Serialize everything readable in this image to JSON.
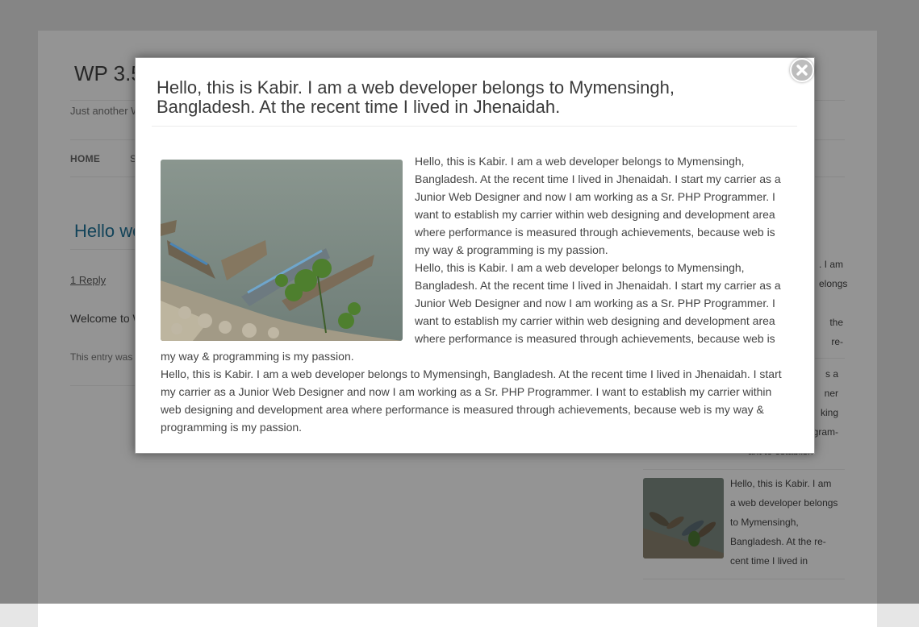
{
  "site": {
    "title": "WP 3.5",
    "description": "Just another W",
    "nav_home": "HOME",
    "nav_second": "S"
  },
  "post": {
    "title": "Hello wo",
    "reply": "1 Reply",
    "welcome": "Welcome to W",
    "entry_meta": "This entry was"
  },
  "sidebar": {
    "widget1_lines": [
      ". I am",
      "elongs",
      "",
      "the re-"
    ],
    "widget2_lines": [
      "s a",
      "ner",
      "king",
      "ogram-",
      "ant to establish"
    ],
    "widget3_lines": [
      "Hello, this is Kabir. I am",
      "a web developer belongs",
      "to Mymensingh,",
      "Bangladesh. At the re-",
      "cent time I lived in"
    ]
  },
  "modal": {
    "title": "Hello, this is Kabir. I am a web developer belongs to Mymensingh, Bangladesh. At the recent time I lived in Jhenaidah.",
    "paragraphs": [
      "Hello, this is Kabir. I am a web developer belongs to Mymensingh, Bangladesh. At the recent time I lived in Jhenaidah. I start my carrier as a Junior Web Designer and now I am working as a Sr. PHP Programmer. I want to establish my carrier within web designing and development area where performance is measured through achievements, because web is my way & programming is my passion.",
      "Hello, this is Kabir. I am a web developer belongs to Mymensingh, Bangladesh. At the recent time I lived in Jhenaidah. I start my carrier as a Junior Web Designer and now I am working as a Sr. PHP Programmer. I want to establish my carrier within web designing and development area where performance is measured through achievements, because web is my way & programming is my passion.",
      "Hello, this is Kabir. I am a web developer belongs to Mymensingh, Bangladesh. At the recent time I lived in Jhenaidah. I start my carrier as a Junior Web Designer and now I am working as a Sr. PHP Programmer. I want to establish my carrier within web designing and development area where performance is measured through achievements, because web is my way & programming is my passion."
    ],
    "close_icon": "close-icon",
    "image_icon": "boats-photo"
  },
  "colors": {
    "accent": "#21759b",
    "overlay": "#000000",
    "text": "#444444"
  }
}
